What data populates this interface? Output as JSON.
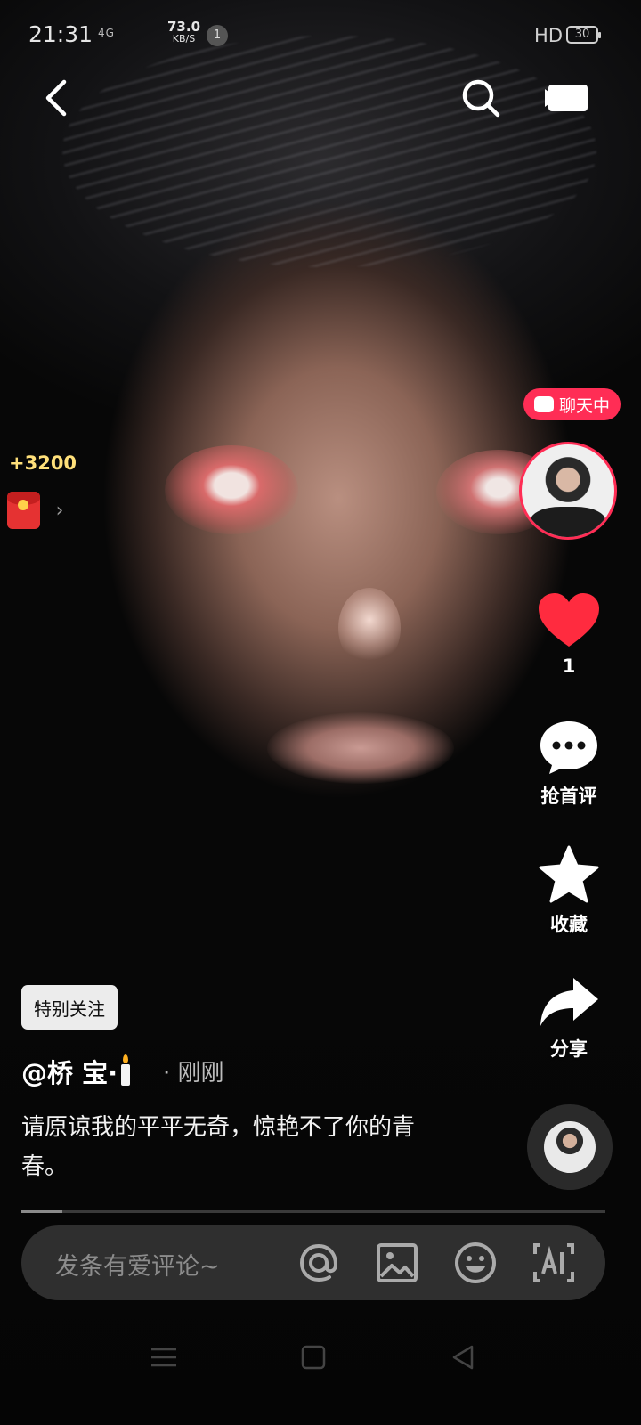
{
  "status_bar": {
    "time": "21:31",
    "network": "4G",
    "speed_value": "73.0",
    "speed_unit": "KB/S",
    "notif_count": "1",
    "hd": "HD",
    "battery": "30"
  },
  "top_bar": {
    "back_icon": "chevron-left-icon",
    "search_icon": "search-icon",
    "camera_icon": "video-camera-icon"
  },
  "reward": {
    "coins": "+3200",
    "arrow": "›"
  },
  "creator": {
    "chat_status": "聊天中"
  },
  "actions": {
    "like_count": "1",
    "comment_label": "抢首评",
    "favorite_label": "收藏",
    "share_label": "分享"
  },
  "post": {
    "special_follow_label": "特别关注",
    "author": "@桥 宝·",
    "time_sep": "·",
    "time_ago": "刚刚",
    "caption": "请原谅我的平平无奇，惊艳不了你的青春。"
  },
  "progress": {
    "played_fraction": 0.07
  },
  "comment_bar": {
    "placeholder": "发条有爱评论~"
  },
  "colors": {
    "accent_pink": "#ff2d55",
    "like_red": "#ff2b3f",
    "coin_gold": "#ffe07a"
  }
}
